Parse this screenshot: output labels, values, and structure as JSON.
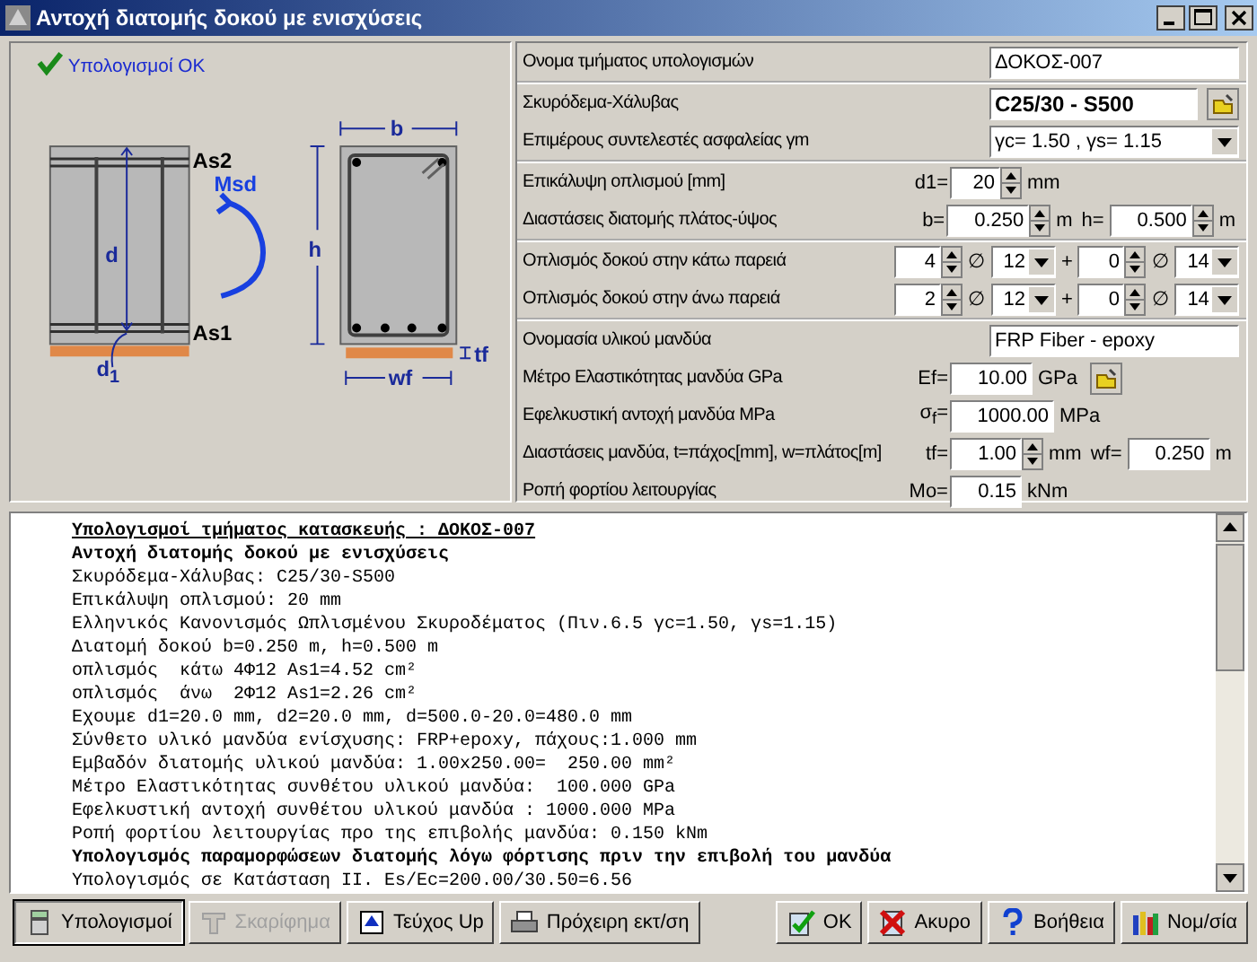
{
  "window": {
    "title": "Αντοχή διατομής δοκού με ενισχύσεις"
  },
  "status": {
    "text": "Υπολογισμοί OK"
  },
  "diagram": {
    "beam_labels": [
      "As2",
      "Msd",
      "d",
      "As1",
      "d$_{1}$"
    ],
    "section_labels": [
      "b",
      "h",
      "tf",
      "wf"
    ]
  },
  "form": {
    "groups": [
      {
        "rows": [
          {
            "label": "Ονομα τμήματος υπολογισμών",
            "controls": [
              {
                "kind": "field",
                "value": "ΔΟΚΟΣ-007",
                "bold": false
              }
            ]
          }
        ]
      },
      {
        "rows": [
          {
            "label": "Σκυρόδεμα-Χάλυβας",
            "controls": [
              {
                "kind": "field",
                "value": "C25/30 - S500",
                "bold": true
              },
              {
                "kind": "button"
              }
            ]
          },
          {
            "label": "Επιμέρους συντελεστές ασφαλείας γm",
            "controls": [
              {
                "kind": "select",
                "value": "γc= 1.50 , γs= 1.15"
              }
            ]
          }
        ]
      },
      {
        "rows": [
          {
            "label": "Επικάλυψη οπλισμού [mm]",
            "controls": [
              {
                "kind": "prefix",
                "text": "d1="
              },
              {
                "kind": "spin",
                "value": "20"
              },
              {
                "kind": "unit",
                "text": "mm"
              }
            ]
          },
          {
            "label": "Διαστάσεις διατομής πλάτος-ύψος",
            "controls": [
              {
                "kind": "prefix",
                "text": "b="
              },
              {
                "kind": "spin",
                "value": "0.250"
              },
              {
                "kind": "unit",
                "text": "m"
              },
              {
                "kind": "unit",
                "text": "h="
              },
              {
                "kind": "spin",
                "value": "0.500"
              },
              {
                "kind": "unit",
                "text": "m"
              }
            ]
          }
        ]
      },
      {
        "rows": [
          {
            "label": "Οπλισμός δοκού στην κάτω παρειά",
            "controls": [
              {
                "kind": "spin",
                "value": "4"
              },
              {
                "kind": "unit",
                "text": "∅"
              },
              {
                "kind": "select",
                "value": "12"
              },
              {
                "kind": "unit",
                "text": "+"
              },
              {
                "kind": "spin",
                "value": "0"
              },
              {
                "kind": "unit",
                "text": "∅"
              },
              {
                "kind": "select",
                "value": "14"
              }
            ]
          },
          {
            "label": "Οπλισμός δοκού στην άνω παρειά",
            "controls": [
              {
                "kind": "spin",
                "value": "2"
              },
              {
                "kind": "unit",
                "text": "∅"
              },
              {
                "kind": "select",
                "value": "12"
              },
              {
                "kind": "unit",
                "text": "+"
              },
              {
                "kind": "spin",
                "value": "0"
              },
              {
                "kind": "unit",
                "text": "∅"
              },
              {
                "kind": "select",
                "value": "14"
              }
            ]
          }
        ]
      },
      {
        "rows": [
          {
            "label": "Ονομασία υλικού μανδύα",
            "controls": [
              {
                "kind": "field",
                "value": "FRP Fiber - epoxy",
                "bold": false
              }
            ]
          },
          {
            "label": "Μέτρο Ελαστικότητας μανδύα GPa",
            "controls": [
              {
                "kind": "prefix",
                "text": "Ef="
              },
              {
                "kind": "number",
                "value": "10.00"
              },
              {
                "kind": "unit",
                "text": "GPa"
              },
              {
                "kind": "button"
              }
            ]
          },
          {
            "label": "Εφελκυστική αντοχή μανδύα MPa",
            "controls": [
              {
                "kind": "prefix",
                "text": "σ$_{f}$="
              },
              {
                "kind": "number",
                "value": "1000.00"
              },
              {
                "kind": "unit",
                "text": "MPa"
              }
            ]
          },
          {
            "label": "Διαστάσεις μανδύα, t=πάχος[mm], w=πλάτος[m]",
            "controls": [
              {
                "kind": "prefix",
                "text": "tf="
              },
              {
                "kind": "spin",
                "value": "1.00"
              },
              {
                "kind": "unit",
                "text": "mm"
              },
              {
                "kind": "unit",
                "text": "wf="
              },
              {
                "kind": "number",
                "value": "0.250"
              },
              {
                "kind": "unit",
                "text": "m"
              }
            ]
          },
          {
            "label": "Ροπή φορτίου λειτουργίας",
            "controls": [
              {
                "kind": "prefix",
                "text": "Mo="
              },
              {
                "kind": "number",
                "value": "0.15"
              },
              {
                "kind": "unit",
                "text": "kNm"
              }
            ]
          }
        ]
      }
    ]
  },
  "report": {
    "lines": [
      {
        "kind": "heading",
        "text": "Υπολογισμοί τμήματος κατασκευής : ΔΟΚΟΣ-007"
      },
      {
        "kind": "bold",
        "text": "Αντοχή διατομής δοκού με ενισχύσεις"
      },
      {
        "kind": "normal",
        "text": "Σκυρόδεμα-Χάλυβας: C25/30-S500"
      },
      {
        "kind": "normal",
        "text": "Επικάλυψη οπλισμού: 20 mm"
      },
      {
        "kind": "normal",
        "text": "Ελληνικός Κανονισμός Ωπλισμένου Σκυροδέματος (Πιν.6.5 γc=1.50, γs=1.15)"
      },
      {
        "kind": "normal",
        "text": "Διατομή δοκού b=0.250 m, h=0.500 m"
      },
      {
        "kind": "normal",
        "text": "οπλισμός  κάτω 4Φ12 As1=4.52 cm²"
      },
      {
        "kind": "normal",
        "text": "οπλισμός  άνω  2Φ12 As1=2.26 cm²"
      },
      {
        "kind": "normal",
        "text": "Εχουμε d1=20.0 mm, d2=20.0 mm, d=500.0-20.0=480.0 mm"
      },
      {
        "kind": "normal",
        "text": "Σύνθετο υλικό μανδύα ενίσχυσης: FRP+epoxy, πάχους:1.000 mm"
      },
      {
        "kind": "normal",
        "text": "Εμβαδόν διατομής υλικού μανδύα: 1.00x250.00=  250.00 mm²"
      },
      {
        "kind": "normal",
        "text": "Μέτρο Ελαστικότητας συνθέτου υλικού μανδύα:  100.000 GPa"
      },
      {
        "kind": "normal",
        "text": "Εφελκυστική αντοχή συνθέτου υλικού μανδύα : 1000.000 MPa"
      },
      {
        "kind": "normal",
        "text": "Ροπή φορτίου λειτουργίας προ της επιβολής μανδύα: 0.150 kNm"
      },
      {
        "kind": "bold",
        "text": "Υπολογισμός παραμορφώσεων διατομής λόγω φόρτισης πριν την επιβολή του μανδύα"
      },
      {
        "kind": "normal",
        "text": "Υπολογισμός σε Κατάσταση ΙΙ. Es/Ec=200.00/30.50=6.56"
      }
    ]
  },
  "buttons": [
    {
      "label": "Υπολογισμοί",
      "selected": true,
      "disabled": false
    },
    {
      "label": "Σκαρίφημα",
      "selected": false,
      "disabled": true
    },
    {
      "label": "Τεύχος Up",
      "selected": false,
      "disabled": false
    },
    {
      "label": "Πρόχειρη εκτ/ση",
      "selected": false,
      "disabled": false
    },
    {
      "label": "OK",
      "selected": false,
      "disabled": false
    },
    {
      "label": "Ακυρο",
      "selected": false,
      "disabled": false
    },
    {
      "label": "Βοήθεια",
      "selected": false,
      "disabled": false
    },
    {
      "label": "Νομ/σία",
      "selected": false,
      "disabled": false
    }
  ]
}
